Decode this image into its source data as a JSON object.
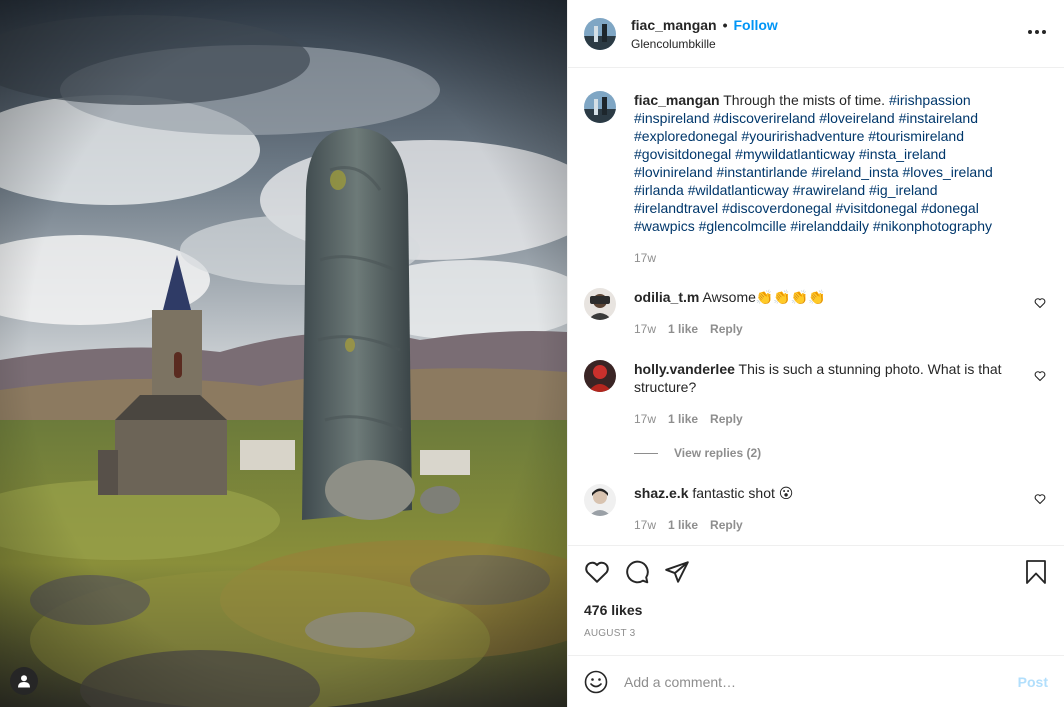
{
  "post": {
    "username": "fiac_mangan",
    "separator": "•",
    "follow_label": "Follow",
    "location": "Glencolumbkille"
  },
  "caption": {
    "username": "fiac_mangan",
    "text": "Through the mists of time.",
    "hashtags": "#irishpassion #inspireland #discoverireland #loveireland #instaireland #exploredonegal #youririshadventure #tourismireland #govisitdonegal #mywildatlanticway #insta_ireland #lovinireland #instantirlande #ireland_insta #loves_ireland #irlanda #wildatlanticway  #rawireland #ig_ireland #irelandtravel #discoverdonegal #visitdonegal #donegal #wawpics #glencolmcille  #irelanddaily #nikonphotography",
    "time": "17w"
  },
  "comments": [
    {
      "username": "odilia_t.m",
      "text": "Awsome👏👏👏👏",
      "time": "17w",
      "likes": "1 like",
      "reply": "Reply"
    },
    {
      "username": "holly.vanderlee",
      "text": "This is such a stunning photo. What is that structure?",
      "time": "17w",
      "likes": "1 like",
      "reply": "Reply"
    },
    {
      "username": "shaz.e.k",
      "text": "fantastic shot 😮",
      "time": "17w",
      "likes": "1 like",
      "reply": "Reply"
    }
  ],
  "view_replies": "View replies (2)",
  "likes_count": "476 likes",
  "date": "AUGUST 3",
  "add_comment": {
    "placeholder": "Add a comment…",
    "post_label": "Post"
  },
  "icons": {
    "more": "more-options-icon",
    "like": "heart-icon",
    "comment": "comment-icon",
    "share": "share-icon",
    "save": "bookmark-icon",
    "emoji": "emoji-icon",
    "user_tag": "user-tag-icon"
  },
  "colors": {
    "link": "#0095f6",
    "hashtag": "#00376b",
    "muted": "#8e8e8e",
    "post_disabled": "#b2dffc"
  }
}
